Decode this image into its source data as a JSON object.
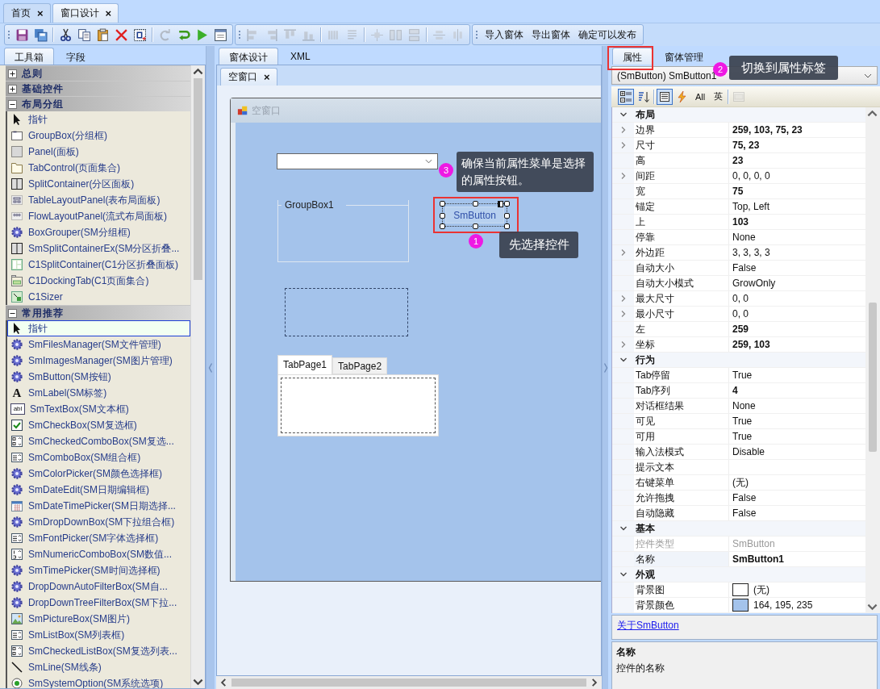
{
  "document_tabs": [
    {
      "label": "首页",
      "close": "×",
      "selected": false
    },
    {
      "label": "窗口设计",
      "close": "×",
      "selected": true
    }
  ],
  "toolbar": {
    "bars": [
      {
        "sections": [
          [
            {
              "kind": "save",
              "disabled": false
            },
            {
              "kind": "saveall",
              "disabled": false
            }
          ],
          [
            {
              "kind": "cut",
              "disabled": false
            },
            {
              "kind": "copy",
              "disabled": false
            },
            {
              "kind": "paste",
              "disabled": false
            },
            {
              "kind": "delete",
              "disabled": false
            },
            {
              "kind": "selectall",
              "disabled": false
            }
          ],
          [
            {
              "kind": "redo",
              "disabled": true
            },
            {
              "kind": "undo",
              "disabled": false
            },
            {
              "kind": "run",
              "disabled": false
            },
            {
              "kind": "form",
              "disabled": false
            }
          ]
        ]
      },
      {
        "sections": [
          [
            {
              "kind": "align-left",
              "disabled": true
            },
            {
              "kind": "align-right",
              "disabled": true
            },
            {
              "kind": "align-top",
              "disabled": true
            },
            {
              "kind": "align-bottom",
              "disabled": true
            }
          ],
          [
            {
              "kind": "bars",
              "disabled": true
            },
            {
              "kind": "lines",
              "disabled": true
            }
          ],
          [
            {
              "kind": "center",
              "disabled": true
            },
            {
              "kind": "hspace",
              "disabled": true
            },
            {
              "kind": "vspace",
              "disabled": true
            }
          ],
          [
            {
              "kind": "center-h",
              "disabled": true
            },
            {
              "kind": "center-v",
              "disabled": true
            }
          ]
        ]
      },
      {
        "buttons": [
          "导入窗体",
          "导出窗体",
          "确定可以发布"
        ]
      }
    ]
  },
  "toolbox": {
    "tabs": [
      {
        "label": "工具箱",
        "selected": true
      },
      {
        "label": "字段",
        "selected": false
      }
    ],
    "groups": [
      {
        "label": "总则",
        "expanded": false
      },
      {
        "label": "基础控件",
        "expanded": false
      },
      {
        "label": "布局分组",
        "expanded": true,
        "items": [
          {
            "kind": "pointer",
            "label": "指针",
            "selected": false
          },
          {
            "kind": "groupbox",
            "label": "GroupBox(分组框)",
            "selected": false
          },
          {
            "kind": "panel",
            "label": "Panel(面板)",
            "selected": false
          },
          {
            "kind": "tabcontrol",
            "label": "TabControl(页面集合)",
            "selected": false
          },
          {
            "kind": "split",
            "label": "SplitContainer(分区面板)",
            "selected": false
          },
          {
            "kind": "tablelayout",
            "label": "TableLayoutPanel(表布局面板)",
            "selected": false
          },
          {
            "kind": "flowlayout",
            "label": "FlowLayoutPanel(流式布局面板)",
            "selected": false
          },
          {
            "kind": "gear",
            "label": "BoxGrouper(SM分组框)",
            "selected": false
          },
          {
            "kind": "split",
            "label": "SmSplitContainerEx(SM分区折叠...",
            "selected": false
          },
          {
            "kind": "c1split",
            "label": "C1SplitContainer(C1分区折叠面板)",
            "selected": false
          },
          {
            "kind": "c1dock",
            "label": "C1DockingTab(C1页面集合)",
            "selected": false
          },
          {
            "kind": "c1sizer",
            "label": "C1Sizer",
            "selected": false
          }
        ]
      },
      {
        "label": "常用推荐",
        "expanded": true,
        "items": [
          {
            "kind": "pointer",
            "label": "指针",
            "selected": true
          },
          {
            "kind": "gear",
            "label": "SmFilesManager(SM文件管理)",
            "selected": false
          },
          {
            "kind": "gear",
            "label": "SmImagesManager(SM图片管理)",
            "selected": false
          },
          {
            "kind": "gear",
            "label": "SmButton(SM按钮)",
            "selected": false
          },
          {
            "kind": "glyph",
            "glyph": "A",
            "label": "SmLabel(SM标签)",
            "selected": false
          },
          {
            "kind": "glyphbox",
            "glyph": "abl",
            "label": "SmTextBox(SM文本框)",
            "selected": false
          },
          {
            "kind": "checkbox",
            "label": "SmCheckBox(SM复选框)",
            "selected": false
          },
          {
            "kind": "checkedcombo",
            "label": "SmCheckedComboBox(SM复选...",
            "selected": false
          },
          {
            "kind": "combo",
            "label": "SmComboBox(SM组合框)",
            "selected": false
          },
          {
            "kind": "gear",
            "label": "SmColorPicker(SM颜色选择框)",
            "selected": false
          },
          {
            "kind": "gear",
            "label": "SmDateEdit(SM日期编辑框)",
            "selected": false
          },
          {
            "kind": "calendar",
            "label": "SmDateTimePicker(SM日期选择...",
            "selected": false
          },
          {
            "kind": "gear",
            "label": "SmDropDownBox(SM下拉组合框)",
            "selected": false
          },
          {
            "kind": "combo",
            "label": "SmFontPicker(SM字体选择框)",
            "selected": false
          },
          {
            "kind": "numeric",
            "label": "SmNumericComboBox(SM数值...",
            "selected": false
          },
          {
            "kind": "gear",
            "label": "SmTimePicker(SM时间选择框)",
            "selected": false
          },
          {
            "kind": "gear",
            "label": "DropDownAutoFilterBox(SM自...",
            "selected": false
          },
          {
            "kind": "gear",
            "label": "DropDownTreeFilterBox(SM下拉...",
            "selected": false
          },
          {
            "kind": "picture",
            "label": "SmPictureBox(SM图片)",
            "selected": false
          },
          {
            "kind": "listbox",
            "label": "SmListBox(SM列表框)",
            "selected": false
          },
          {
            "kind": "checkedcombo",
            "label": "SmCheckedListBox(SM复选列表...",
            "selected": false
          },
          {
            "kind": "line",
            "label": "SmLine(SM线条)",
            "selected": false
          },
          {
            "kind": "radio",
            "label": "SmSystemOption(SM系统选项)",
            "selected": false
          }
        ]
      }
    ]
  },
  "designer": {
    "tabs": [
      {
        "label": "窗体设计",
        "selected": true
      },
      {
        "label": "XML",
        "selected": false
      }
    ],
    "document_tab": {
      "label": "空窗口",
      "close": "×"
    },
    "form": {
      "title": "空窗口",
      "controls": [
        {
          "kind": "combobox",
          "selected": false,
          "highlighted": false
        },
        {
          "kind": "groupbox",
          "text": "GroupBox1",
          "selected": false,
          "highlighted": false
        },
        {
          "kind": "button",
          "text": "SmButton",
          "selected": true,
          "highlighted": true
        },
        {
          "kind": "panel",
          "selected": false,
          "highlighted": false
        },
        {
          "kind": "tabcontrol",
          "selected": false,
          "highlighted": false,
          "tabs": [
            {
              "label": "TabPage1",
              "selected": true
            },
            {
              "label": "TabPage2",
              "selected": false
            }
          ]
        }
      ]
    },
    "callout": {
      "number": "1",
      "text": "先选择控件"
    }
  },
  "properties": {
    "tabs": [
      {
        "label": "属性",
        "selected": true,
        "highlighted": true
      },
      {
        "label": "窗体管理",
        "selected": false,
        "highlighted": false
      }
    ],
    "tab_callout": {
      "number": "2",
      "text": "切换到属性标签"
    },
    "object_selector": "(SmButton) SmButton1",
    "toolbar": [
      {
        "kind": "categorized",
        "selected": true,
        "disabled": false
      },
      {
        "kind": "alphabetical",
        "selected": false,
        "disabled": false
      },
      {
        "kind": "properties",
        "selected": true,
        "disabled": false
      },
      {
        "kind": "events",
        "selected": false,
        "disabled": false
      },
      {
        "kind": "text",
        "label": "All",
        "selected": false,
        "disabled": false
      },
      {
        "kind": "text",
        "label": "英",
        "selected": false,
        "disabled": false
      },
      {
        "kind": "pages",
        "selected": false,
        "disabled": true
      }
    ],
    "view_callout": {
      "number": "3",
      "text": "确保当前属性菜单是选择的属性按钮。"
    },
    "categories": [
      {
        "name": "布局",
        "expanded": true,
        "properties": [
          {
            "name": "边界",
            "value": "259, 103, 75, 23",
            "expandable": true,
            "modified": true,
            "disabled": false,
            "selected": false
          },
          {
            "name": "尺寸",
            "value": "75, 23",
            "expandable": true,
            "modified": true,
            "disabled": false,
            "selected": false
          },
          {
            "name": "高",
            "value": "23",
            "expandable": false,
            "modified": true,
            "disabled": false,
            "selected": false
          },
          {
            "name": "间距",
            "value": "0, 0, 0, 0",
            "expandable": true,
            "modified": false,
            "disabled": false,
            "selected": false
          },
          {
            "name": "宽",
            "value": "75",
            "expandable": false,
            "modified": true,
            "disabled": false,
            "selected": false
          },
          {
            "name": "锚定",
            "value": "Top, Left",
            "expandable": false,
            "modified": false,
            "disabled": false,
            "selected": false
          },
          {
            "name": "上",
            "value": "103",
            "expandable": false,
            "modified": true,
            "disabled": false,
            "selected": false
          },
          {
            "name": "停靠",
            "value": "None",
            "expandable": false,
            "modified": false,
            "disabled": false,
            "selected": false
          },
          {
            "name": "外边距",
            "value": "3, 3, 3, 3",
            "expandable": true,
            "modified": false,
            "disabled": false,
            "selected": false
          },
          {
            "name": "自动大小",
            "value": "False",
            "expandable": false,
            "modified": false,
            "disabled": false,
            "selected": false
          },
          {
            "name": "自动大小模式",
            "value": "GrowOnly",
            "expandable": false,
            "modified": false,
            "disabled": false,
            "selected": false
          },
          {
            "name": "最大尺寸",
            "value": "0, 0",
            "expandable": true,
            "modified": false,
            "disabled": false,
            "selected": false
          },
          {
            "name": "最小尺寸",
            "value": "0, 0",
            "expandable": true,
            "modified": false,
            "disabled": false,
            "selected": false
          },
          {
            "name": "左",
            "value": "259",
            "expandable": false,
            "modified": true,
            "disabled": false,
            "selected": false
          },
          {
            "name": "坐标",
            "value": "259, 103",
            "expandable": true,
            "modified": true,
            "disabled": false,
            "selected": false
          }
        ]
      },
      {
        "name": "行为",
        "expanded": true,
        "properties": [
          {
            "name": "Tab停留",
            "value": "True",
            "expandable": false,
            "modified": false,
            "disabled": false,
            "selected": false
          },
          {
            "name": "Tab序列",
            "value": "4",
            "expandable": false,
            "modified": true,
            "disabled": false,
            "selected": false
          },
          {
            "name": "对话框结果",
            "value": "None",
            "expandable": false,
            "modified": false,
            "disabled": false,
            "selected": false
          },
          {
            "name": "可见",
            "value": "True",
            "expandable": false,
            "modified": false,
            "disabled": false,
            "selected": false
          },
          {
            "name": "可用",
            "value": "True",
            "expandable": false,
            "modified": false,
            "disabled": false,
            "selected": false
          },
          {
            "name": "输入法模式",
            "value": "Disable",
            "expandable": false,
            "modified": false,
            "disabled": false,
            "selected": false
          },
          {
            "name": "提示文本",
            "expandable": false,
            "disabled": false,
            "selected": false
          },
          {
            "name": "右键菜单",
            "value": "(无)",
            "expandable": false,
            "modified": false,
            "disabled": false,
            "selected": false
          },
          {
            "name": "允许拖拽",
            "value": "False",
            "expandable": false,
            "modified": false,
            "disabled": false,
            "selected": false
          },
          {
            "name": "自动隐藏",
            "value": "False",
            "expandable": false,
            "modified": false,
            "disabled": false,
            "selected": false
          }
        ]
      },
      {
        "name": "基本",
        "expanded": true,
        "properties": [
          {
            "name": "控件类型",
            "value": "SmButton",
            "expandable": false,
            "modified": false,
            "disabled": true,
            "selected": false
          },
          {
            "name": "名称",
            "value": "SmButton1",
            "expandable": false,
            "modified": true,
            "disabled": false,
            "selected": true
          }
        ]
      },
      {
        "name": "外观",
        "expanded": true,
        "properties": [
          {
            "name": "背景图",
            "value": "(无)",
            "color": "#ffffff",
            "expandable": false,
            "modified": false,
            "disabled": false,
            "selected": false
          },
          {
            "name": "背景颜色",
            "value": "164, 195, 235",
            "color": "#a4c3eb",
            "expandable": false,
            "modified": false,
            "disabled": false,
            "selected": false
          }
        ]
      }
    ],
    "help_link": "关于SmButton",
    "description": {
      "title": "名称",
      "text": "控件的名称"
    }
  }
}
